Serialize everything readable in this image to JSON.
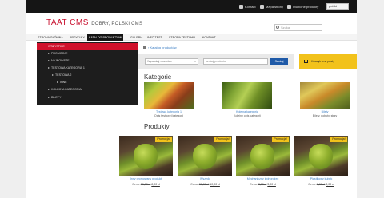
{
  "topbar": {
    "items": [
      {
        "icon": "user-icon",
        "label": "Kontakt"
      },
      {
        "icon": "sitemap-icon",
        "label": "Mapa strony"
      },
      {
        "icon": "basket-icon",
        "label": "Ulubione produkty"
      }
    ],
    "language": "polski"
  },
  "header": {
    "logo_main": "TAAT CMS",
    "logo_tagline": "DOBRY, POLSKI CMS",
    "search_placeholder": "Szukaj"
  },
  "nav": {
    "items": [
      "STRONA GŁÓWNA",
      "ARTYKUŁY",
      "KATALOG PRODUKTÓW",
      "GALERIA",
      "INFO TEST",
      "STRONA TESTOWA",
      "KONTAKT"
    ],
    "active_index": 2
  },
  "sidebar": {
    "items": [
      {
        "label": "WSZYSTKIE",
        "level": 0,
        "active": true
      },
      {
        "label": "PROMOCJE",
        "level": 0
      },
      {
        "label": "NAJNOWSZE",
        "level": 0
      },
      {
        "label": "TESTOWA KATEGORIA 1",
        "level": 0
      },
      {
        "label": "TESTOWA 2",
        "level": 1
      },
      {
        "label": "INNE",
        "level": 2
      },
      {
        "label": "KOLEJNA KATEGORIA",
        "level": 0
      },
      {
        "label": "BILETY",
        "level": 0
      }
    ]
  },
  "breadcrumb": {
    "label": "Katalog produktów"
  },
  "filter": {
    "select_value": "Wyszukaj wszędzie",
    "input_placeholder": "szukaj produktu",
    "button_label": "Szukaj"
  },
  "cart": {
    "label": "Koszyk jest pusty"
  },
  "categories": {
    "heading": "Kategorie",
    "items": [
      {
        "name": "Testowa kategoria 1",
        "desc": "Opis testowej kategorii"
      },
      {
        "name": "Kolejna kategoria",
        "desc": "Kolejny opis kategorii"
      },
      {
        "name": "Bilety",
        "desc": "Bilety, pobyty, strzy"
      }
    ]
  },
  "products": {
    "heading": "Produkty",
    "badge_label": "Promocja!",
    "price_label": "Cena:",
    "items": [
      {
        "name": "Inny promowany produkt",
        "old_price": "20,00 zł",
        "new_price": "8,00 zł"
      },
      {
        "name": "Wszedo",
        "old_price": "20,00 zł",
        "new_price": "10,00 zł"
      },
      {
        "name": "Mechaniczny jednorożec",
        "old_price": "7,00 zł",
        "new_price": "3,00 zł"
      },
      {
        "name": "Plastikowy kubek",
        "old_price": "7,00 zł",
        "new_price": "3,00 zł"
      }
    ]
  }
}
